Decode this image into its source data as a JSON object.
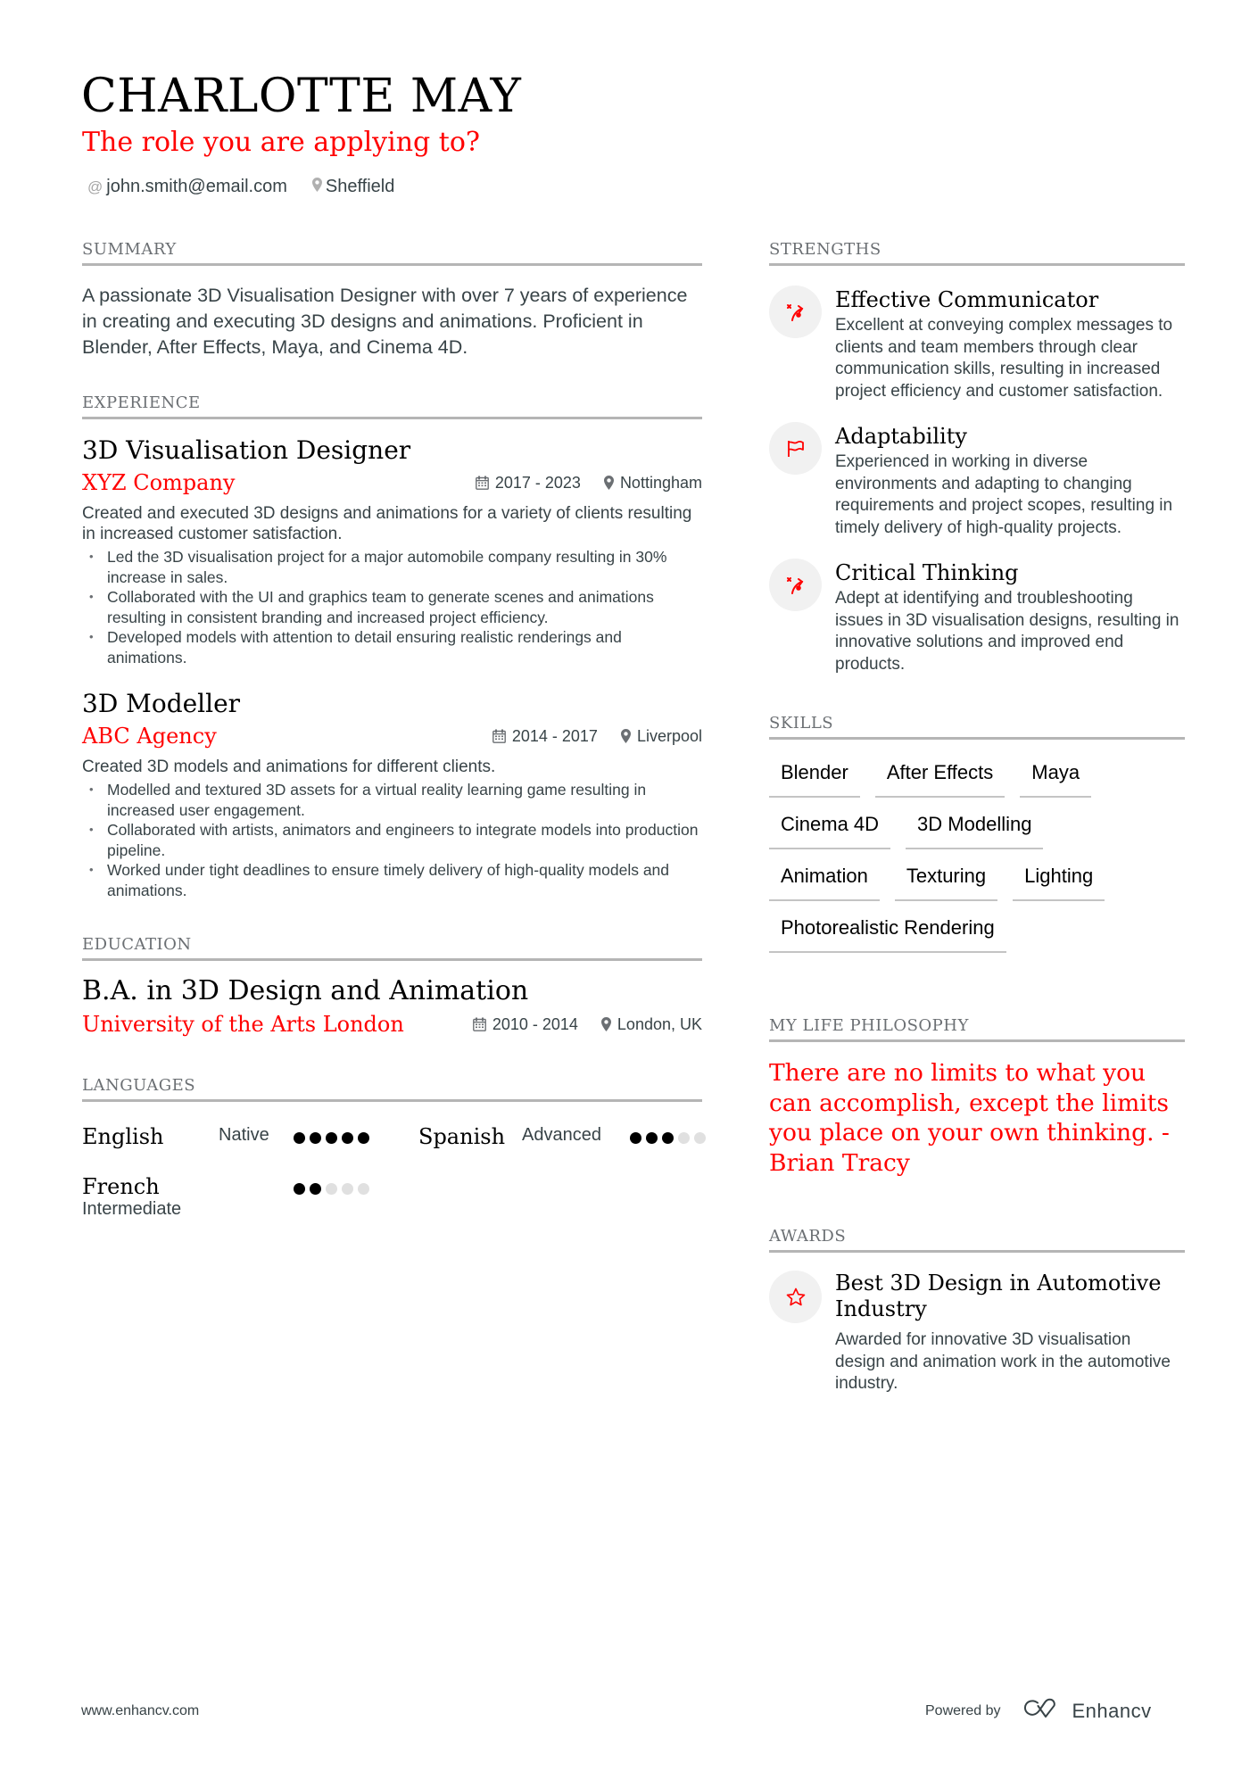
{
  "header": {
    "name": "CHARLOTTE MAY",
    "role": "The role you are applying to?",
    "contacts": [
      {
        "icon": "at-icon",
        "glyph": "@",
        "text": "john.smith@email.com"
      },
      {
        "icon": "location-pin-icon",
        "glyph": "",
        "text": "Sheffield"
      }
    ]
  },
  "summary": {
    "title": "SUMMARY",
    "text": "A passionate 3D Visualisation Designer with over 7 years of experience in creating and executing 3D designs and animations. Proficient in Blender, After Effects, Maya, and Cinema 4D."
  },
  "experience": {
    "title": "EXPERIENCE",
    "jobs": [
      {
        "title": "3D Visualisation Designer",
        "company": "XYZ Company",
        "dates": "2017 - 2023",
        "location": "Nottingham",
        "description": "Created and executed 3D designs and animations for a variety of clients resulting in increased customer satisfaction.",
        "bullets": [
          "Led the 3D visualisation project for a major automobile company resulting in 30% increase in sales.",
          "Collaborated with the UI and graphics team to generate scenes and animations resulting in consistent branding and increased project efficiency.",
          "Developed models with attention to detail ensuring realistic renderings and animations."
        ]
      },
      {
        "title": "3D Modeller",
        "company": "ABC Agency",
        "dates": "2014 - 2017",
        "location": "Liverpool",
        "description": "Created 3D models and animations for different clients.",
        "bullets": [
          "Modelled and textured 3D assets for a virtual reality learning game resulting in increased user engagement.",
          "Collaborated with artists, animators and engineers to integrate models into production pipeline.",
          "Worked under tight deadlines to ensure timely delivery of high-quality models and animations."
        ]
      }
    ]
  },
  "education": {
    "title": "EDUCATION",
    "degree": "B.A. in 3D Design and Animation",
    "school": "University of the Arts London",
    "dates": "2010 - 2014",
    "location": "London, UK"
  },
  "languages": {
    "title": "LANGUAGES",
    "items": [
      {
        "name": "English",
        "level": "Native",
        "rating": 5,
        "max": 5
      },
      {
        "name": "Spanish",
        "level": "Advanced",
        "rating": 3,
        "max": 5
      },
      {
        "name": "French",
        "level": "Intermediate",
        "rating": 2,
        "max": 5
      }
    ]
  },
  "strengths": {
    "title": "STRENGTHS",
    "items": [
      {
        "icon": "strategy-icon",
        "title": "Effective Communicator",
        "description": "Excellent at conveying complex messages to clients and team members through clear communication skills, resulting in increased project efficiency and customer satisfaction."
      },
      {
        "icon": "flag-icon",
        "title": "Adaptability",
        "description": "Experienced in working in diverse environments and adapting to changing requirements and project scopes, resulting in timely delivery of high-quality projects."
      },
      {
        "icon": "strategy-icon",
        "title": "Critical Thinking",
        "description": "Adept at identifying and troubleshooting issues in 3D visualisation designs, resulting in innovative solutions and improved end products."
      }
    ]
  },
  "skills": {
    "title": "SKILLS",
    "items": [
      "Blender",
      "After Effects",
      "Maya",
      "Cinema 4D",
      "3D Modelling",
      "Animation",
      "Texturing",
      "Lighting",
      "Photorealistic Rendering"
    ]
  },
  "philosophy": {
    "title": "MY LIFE PHILOSOPHY",
    "quote": "There are no limits to what you can accomplish, except the limits you place on your own thinking. - Brian Tracy"
  },
  "awards": {
    "title": "AWARDS",
    "items": [
      {
        "icon": "star-icon",
        "title": "Best 3D Design in Automotive Industry",
        "description": "Awarded for innovative 3D visualisation design and animation work in the automotive industry."
      }
    ]
  },
  "footer": {
    "website": "www.enhancv.com",
    "powered_by": "Powered by",
    "brand": "Enhancv"
  },
  "colors": {
    "accent": "#ff0000",
    "text": "#384347",
    "heading": "#000000",
    "section_title": "#6b6f73",
    "rule": "#b5b5b5",
    "icon_bg": "#f1f1f1",
    "dot_on": "#000000",
    "dot_off": "#e0e0e0"
  }
}
